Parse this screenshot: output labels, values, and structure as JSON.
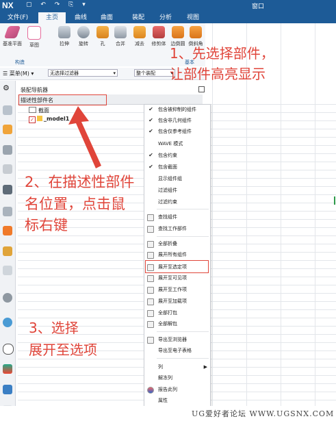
{
  "titlebar": {
    "logo": "NX",
    "window_menu": "窗口"
  },
  "tabs": [
    {
      "label": "文件(F)",
      "active": false
    },
    {
      "label": "主页",
      "active": true
    },
    {
      "label": "曲线",
      "active": false
    },
    {
      "label": "曲面",
      "active": false
    },
    {
      "label": "装配",
      "active": false
    },
    {
      "label": "分析",
      "active": false
    },
    {
      "label": "视图",
      "active": false
    }
  ],
  "ribbon": {
    "buttons": [
      "基准平面",
      "草图",
      "拉伸",
      "旋转",
      "孔",
      "合并",
      "减去",
      "修剪体",
      "边倒圆",
      "倒斜角"
    ],
    "groups": [
      "构造",
      "基本"
    ]
  },
  "filterbar": {
    "menu": "菜单(M)",
    "filter": "无选择过滤器",
    "scope": "整个装配"
  },
  "navigator": {
    "title": "装配导航器",
    "column_header": "描述性部件名",
    "tree": [
      {
        "label": "截面"
      },
      {
        "label": "_model1"
      }
    ]
  },
  "context_menu": {
    "items": [
      {
        "label": "包含被抑制的组件",
        "mark": "✔"
      },
      {
        "label": "包含非几何组件",
        "mark": "✔"
      },
      {
        "label": "包含仅参考组件",
        "mark": "✔"
      },
      {
        "label": "WAVE 模式",
        "mark": ""
      },
      {
        "label": "包含约束",
        "mark": "✔"
      },
      {
        "label": "包含截面",
        "mark": "✔"
      },
      {
        "label": "显示组件组",
        "mark": ""
      },
      {
        "label": "过滤组件",
        "mark": ""
      },
      {
        "label": "过滤约束",
        "mark": ""
      },
      {
        "label": "查找组件",
        "icon": true
      },
      {
        "label": "查找工作部件",
        "icon": true
      },
      {
        "label": "全部折叠",
        "icon": true
      },
      {
        "label": "展开所有组件",
        "icon": true
      },
      {
        "label": "展开至选定项",
        "icon": true,
        "highlighted": true
      },
      {
        "label": "展开至可见项",
        "icon": true
      },
      {
        "label": "展开至工作项",
        "icon": true
      },
      {
        "label": "展开至加载项",
        "icon": true
      },
      {
        "label": "全部打包",
        "icon": true
      },
      {
        "label": "全部解包",
        "icon": true
      },
      {
        "label": "导出至浏览器",
        "icon": true
      },
      {
        "label": "导出至电子表格",
        "icon": true
      },
      {
        "label": "列",
        "submenu": true
      },
      {
        "label": "解冻列"
      },
      {
        "label": "报告此列",
        "icon": true
      },
      {
        "label": "属性"
      }
    ],
    "submenu_arrow": "▶"
  },
  "annotations": {
    "step1_line1": "1、先选择部件，",
    "step1_line2": "让部件高亮显示",
    "step2_line1": "2、在描述性部件",
    "step2_line2": "名位置，点击鼠",
    "step2_line3": "标右键",
    "step3_line1": "3、选择",
    "step3_line2": "展开至选项"
  },
  "footer": {
    "watermark": "UG爱好者论坛 WWW.UGSNX.COM"
  },
  "colors": {
    "title_bar": "#1d5b97",
    "annotation_red": "#e0453a",
    "ribbon_bg": "#f4f6f9"
  }
}
